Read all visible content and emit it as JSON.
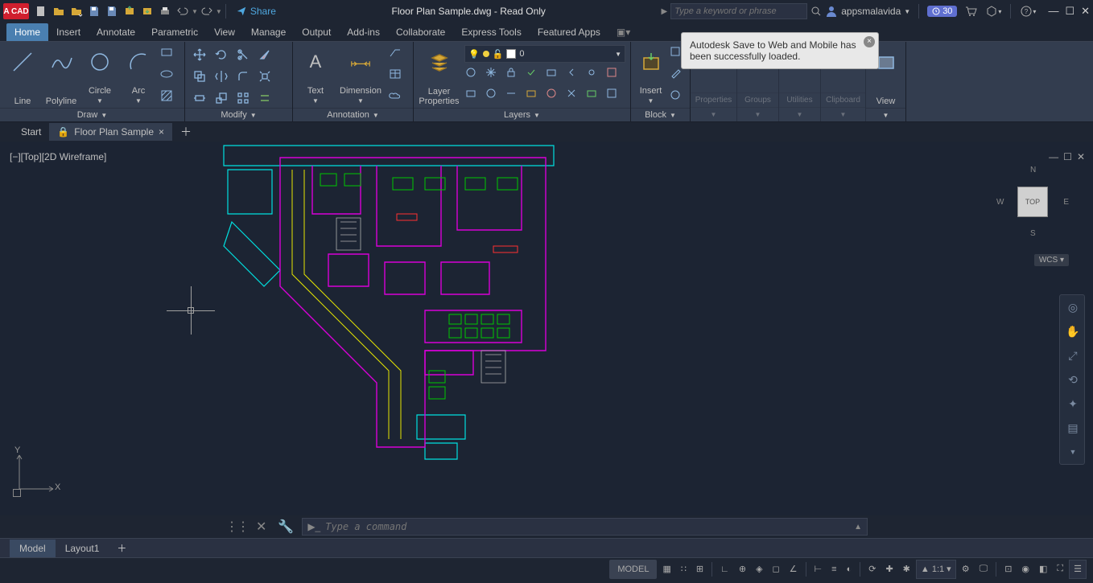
{
  "titlebar": {
    "logo_text": "A CAD",
    "share": "Share",
    "title": "Floor Plan Sample.dwg - Read Only",
    "search_placeholder": "Type a keyword or phrase",
    "username": "appsmalavida",
    "trial_days": "30"
  },
  "ribbon_tabs": [
    "Home",
    "Insert",
    "Annotate",
    "Parametric",
    "View",
    "Manage",
    "Output",
    "Add-ins",
    "Collaborate",
    "Express Tools",
    "Featured Apps"
  ],
  "ribbon": {
    "draw": {
      "title": "Draw",
      "line": "Line",
      "polyline": "Polyline",
      "circle": "Circle",
      "arc": "Arc"
    },
    "modify": {
      "title": "Modify"
    },
    "annotation": {
      "title": "Annotation",
      "text": "Text",
      "dimension": "Dimension"
    },
    "layers": {
      "title": "Layers",
      "properties": "Layer\nProperties",
      "current": "0"
    },
    "block": {
      "title": "Block",
      "insert": "Insert"
    },
    "collapsed": {
      "properties": "Properties",
      "groups": "Groups",
      "utilities": "Utilities",
      "clipboard": "Clipboard",
      "view": "View"
    }
  },
  "toast": {
    "text": "Autodesk Save to Web and Mobile has been successfully loaded."
  },
  "file_tabs": {
    "start": "Start",
    "active": "Floor Plan Sample"
  },
  "viewport": {
    "label": "[−][Top][2D Wireframe]",
    "cube_top": "TOP",
    "cube_n": "N",
    "cube_s": "S",
    "cube_e": "E",
    "cube_w": "W",
    "wcs": "WCS",
    "ucs_x": "X",
    "ucs_y": "Y"
  },
  "cmdline": {
    "placeholder": "Type a command"
  },
  "layout_tabs": {
    "model": "Model",
    "layout1": "Layout1"
  },
  "statusbar": {
    "model": "MODEL",
    "scale": "1:1"
  }
}
